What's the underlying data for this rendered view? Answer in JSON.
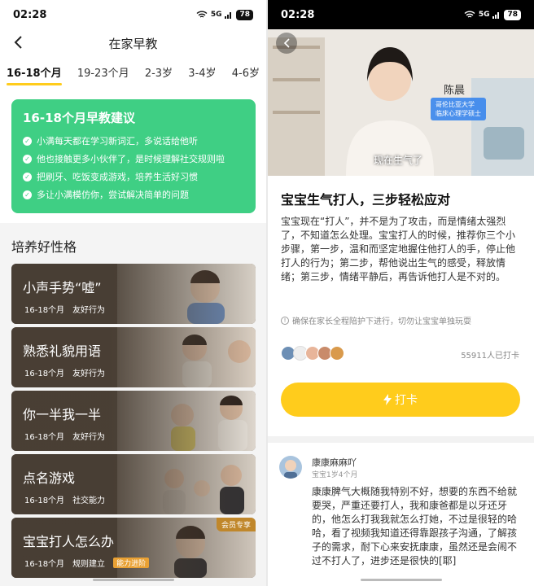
{
  "status": {
    "time": "02:28",
    "battery": "78",
    "signal": "5G"
  },
  "left": {
    "title": "在家早教",
    "tabs": [
      "16-18个月",
      "19-23个月",
      "2-3岁",
      "3-4岁",
      "4-6岁"
    ],
    "active_tab": "16-18个月",
    "advice": {
      "title": "16-18个月早教建议",
      "items": [
        "小满每天都在学习新词汇，多说话给他听",
        "他也接触更多小伙伴了，是时候理解社交规则啦",
        "把刷牙、吃饭变成游戏，培养生活好习惯",
        "多让小满模仿你，尝试解决简单的问题"
      ]
    },
    "section_title": "培养好性格",
    "cards": [
      {
        "title": "小声手势“嘘”",
        "age": "16-18个月",
        "tag": "友好行为"
      },
      {
        "title": "熟悉礼貌用语",
        "age": "16-18个月",
        "tag": "友好行为"
      },
      {
        "title": "你一半我一半",
        "age": "16-18个月",
        "tag": "友好行为"
      },
      {
        "title": "点名游戏",
        "age": "16-18个月",
        "tag": "社交能力"
      },
      {
        "title": "宝宝打人怎么办",
        "age": "16-18个月",
        "tag": "规则建立",
        "badge": "能力进阶",
        "vip": "会员专享"
      }
    ]
  },
  "right": {
    "video": {
      "name": "陈晨",
      "credential_line1": "哥伦比亚大学",
      "credential_line2": "临床心理学硕士",
      "subtitle": "现在生气了"
    },
    "title": "宝宝生气打人，三步轻松应对",
    "body": "宝宝现在“打人”，并不是为了攻击，而是情绪太强烈了，不知道怎么处理。宝宝打人的时候，推荐你三个小步骤，第一步，温和而坚定地握住他打人的手，停止他打人的行为；第二步，帮他说出生气的感受，释放情绪；第三步，情绪平静后，再告诉他打人是不对的。",
    "notice": "确保在家长全程陪护下进行，切勿让宝宝单独玩耍",
    "checkin_count": "55911人已打卡",
    "checkin_label": "打卡",
    "comment": {
      "user": "康康麻麻吖",
      "meta": "宝宝1岁4个月",
      "text": "康康脾气大概随我特别不好，想要的东西不给就要哭，严重还要打人，我和康爸都是以牙还牙的，他怎么打我我就怎么打她，不过是很轻的哈哈，看了视频我知道还得靠跟孩子沟通，了解孩子的需求，耐下心来安抚康康，虽然还是会闹不过不打人了，进步还是很快的[耶]"
    }
  },
  "colors": {
    "accent": "#ffcc1c",
    "advice_green": "#3fcf84",
    "vip_gold": "#c0872b"
  }
}
